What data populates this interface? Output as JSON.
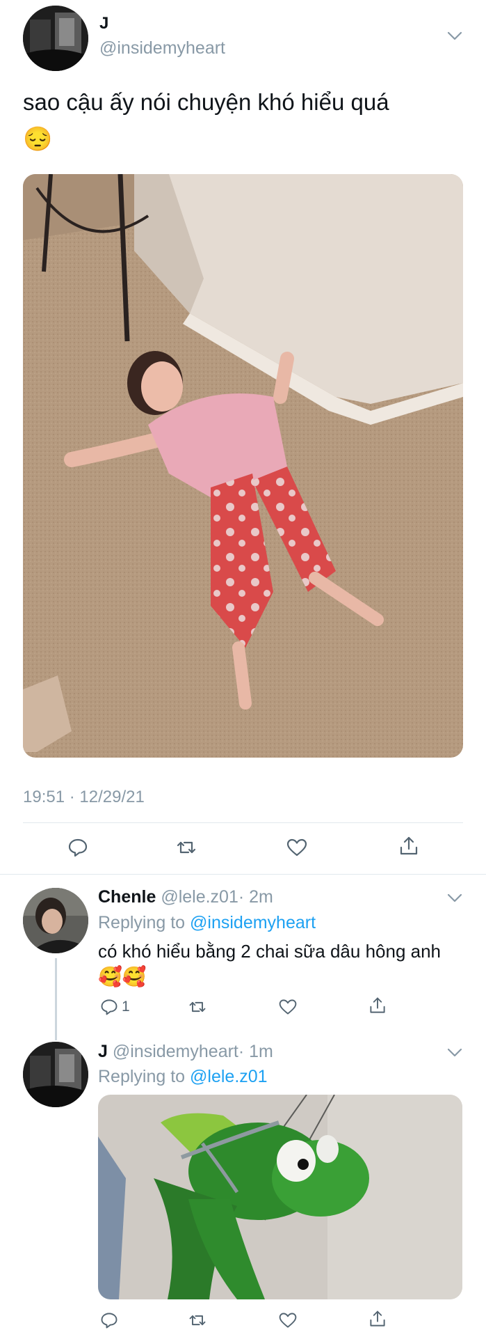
{
  "main_tweet": {
    "display_name": "J",
    "handle": "@insidemyheart",
    "text": "sao cậu ấy nói chuyện khó hiểu quá",
    "emoji": "😔",
    "timestamp": "19:51 · 12/29/21",
    "image_icon": "photo-girl-lying-on-carpet",
    "actions": [
      "reply-icon",
      "retweet-icon",
      "like-icon",
      "share-icon"
    ]
  },
  "reply1": {
    "display_name": "Chenle",
    "handle": "@lele.z01",
    "time": "· 2m",
    "replying_prefix": "Replying to",
    "replying_handle": "@insidemyheart",
    "text": "có khó hiểu bằng 2 chai sữa dâu hông anh",
    "emoji": "🥰🥰",
    "reply_count": "1"
  },
  "reply2": {
    "display_name": "J",
    "handle": "@insidemyheart",
    "time": "· 1m",
    "replying_prefix": "Replying to",
    "replying_handle": "@lele.z01",
    "image_icon": "photo-kermit-frog-hanging"
  },
  "colors": {
    "link": "#1da1f2",
    "muted": "#8899a6",
    "divider": "#e1e8ed",
    "text": "#0f1419"
  }
}
